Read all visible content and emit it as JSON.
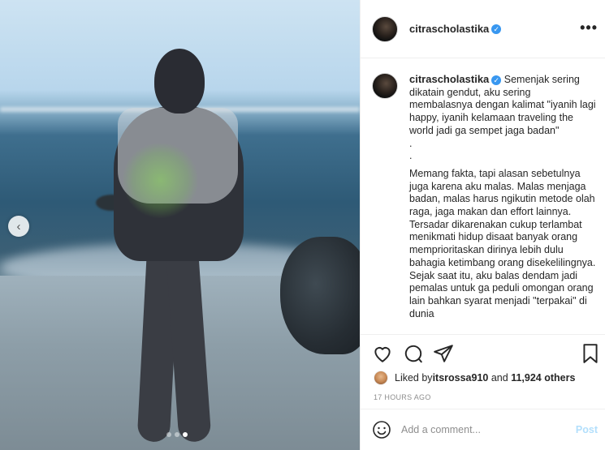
{
  "post": {
    "username": "citrascholastika",
    "verified_icon": "verified-badge-icon",
    "more_label": "•••",
    "carousel": {
      "prev_glyph": "‹",
      "dots": 3,
      "active_dot": 2
    }
  },
  "caption": {
    "username": "citrascholastika",
    "text_1": " Semenjak sering dikatain gendut, aku sering membalasnya dengan kalimat \"iyanih lagi happy, iyanih kelamaan traveling the world jadi ga sempet jaga badan\"",
    "sep_1": ".",
    "sep_2": ".",
    "text_2": "Memang fakta, tapi alasan sebetulnya juga karena aku malas. Malas menjaga badan, malas harus ngikutin metode olah raga, jaga makan dan effort lainnya. Tersadar dikarenakan cukup terlambat menikmati hidup disaat banyak orang memprioritaskan dirinya lebih dulu bahagia ketimbang orang disekelilingnya. Sejak saat itu, aku balas dendam jadi pemalas untuk ga peduli omongan orang lain bahkan syarat menjadi \"terpakai\" di dunia"
  },
  "actions": {
    "icons": [
      "heart-icon",
      "comment-icon",
      "share-icon",
      "bookmark-icon"
    ]
  },
  "likes": {
    "prefix": "Liked by ",
    "user": "itsrossa910",
    "middle": " and ",
    "count": "11,924 others"
  },
  "timestamp": "17 HOURS AGO",
  "comment": {
    "placeholder": "Add a comment...",
    "post_label": "Post"
  }
}
